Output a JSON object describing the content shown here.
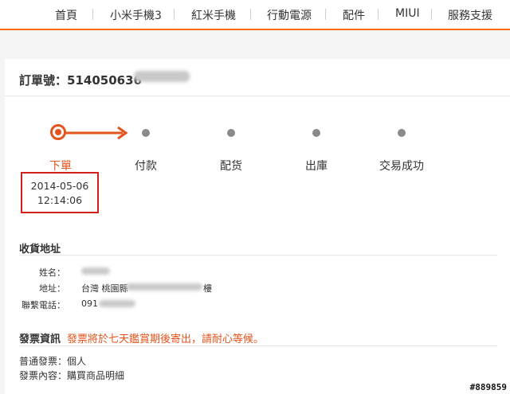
{
  "nav": {
    "items": [
      "首頁",
      "小米手機3",
      "紅米手機",
      "行動電源",
      "配件",
      "MIUI",
      "服務支援"
    ]
  },
  "order": {
    "label": "訂單號：",
    "number_visible": "514050636"
  },
  "progress": {
    "steps": [
      "下單",
      "付款",
      "配货",
      "出庫",
      "交易成功"
    ],
    "current_index": 0,
    "date": "2014-05-06",
    "time": "12:14:06"
  },
  "address": {
    "title": "收貨地址",
    "name_label": "姓名：",
    "addr_label": "地址：",
    "addr_value_visible": "台灣 桃園縣",
    "addr_tail": "樓",
    "phone_label": "聯繫電話：",
    "phone_visible": "091"
  },
  "invoice": {
    "title": "發票資訊",
    "notice": "發票將於七天鑑賞期後寄出，請耐心等候。",
    "type_line": "普通發票：個人",
    "content_line": "發票內容：購買商品明細"
  },
  "watermark": "#889859",
  "colors": {
    "accent": "#e5541c",
    "nav_line": "#ff6700",
    "highlight_box": "#d0211c"
  }
}
